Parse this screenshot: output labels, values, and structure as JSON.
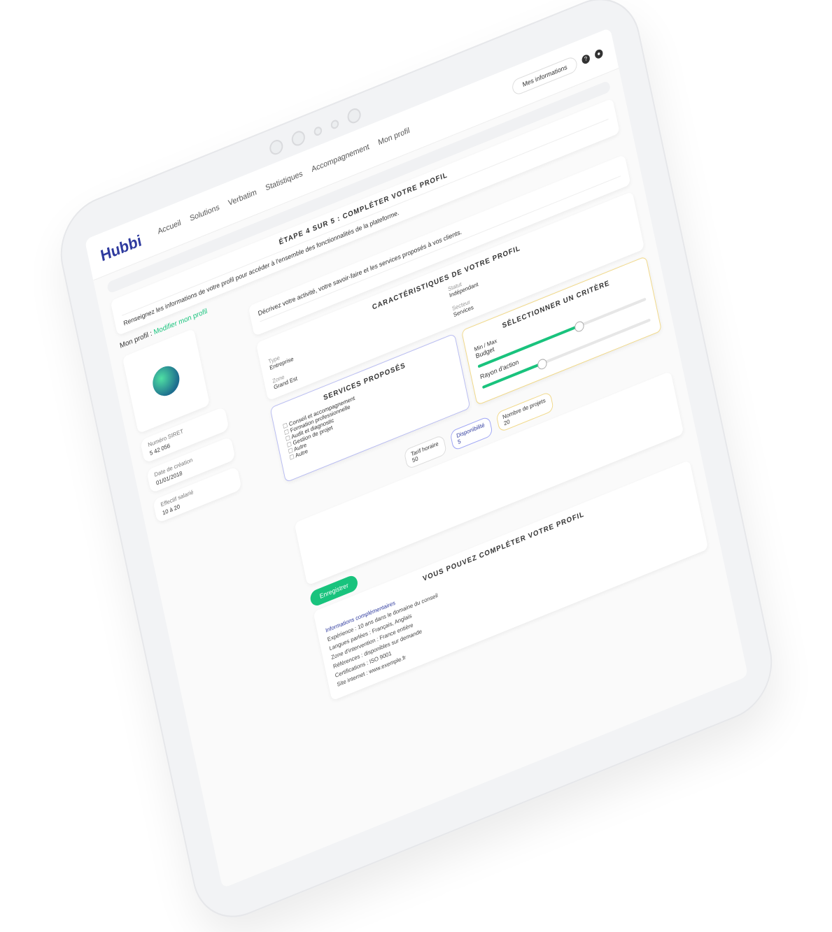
{
  "app": {
    "logo": "Hubbi",
    "logo_sub": ""
  },
  "nav": [
    "Accueil",
    "Solutions",
    "Verbatim",
    "Statistiques",
    "Accompagnement",
    "Mon profil"
  ],
  "topbar": {
    "button": "Mes informations",
    "help_icon": "?",
    "user_icon": "●"
  },
  "banner": {
    "title": "ÉTAPE 4 SUR 5 : COMPLÉTER VOTRE PROFIL",
    "title_green": "COMPLÉTER VOTRE PROFIL",
    "text": "Renseignez les informations de votre profil pour accéder à l'ensemble des fonctionnalités de la plateforme."
  },
  "crumb": {
    "prefix": "Mon profil :",
    "link": "Modifier mon profil"
  },
  "left": {
    "fields": [
      {
        "label": "Numéro SIRET",
        "value": "5 42 056"
      },
      {
        "label": "Date de création",
        "value": "01/01/2018"
      },
      {
        "label": "Effectif salarié",
        "value": "10 à 20"
      }
    ]
  },
  "description_card": {
    "text": "Décrivez votre activité, votre savoir-faire et les services proposés à vos clients."
  },
  "characteristics": {
    "title": "CARACTÉRISTIQUES DE VOTRE PROFIL",
    "items": [
      {
        "k": "Type",
        "v": "Entreprise"
      },
      {
        "k": "Statut",
        "v": "Indépendant"
      },
      {
        "k": "Zone",
        "v": "Grand Est"
      },
      {
        "k": "Secteur",
        "v": "Services"
      }
    ]
  },
  "services": {
    "title": "SERVICES PROPOSÉS",
    "items": [
      "Conseil et accompagnement",
      "Formation professionnelle",
      "Audit et diagnostic",
      "Gestion de projet",
      "Autre",
      "Autre"
    ]
  },
  "selection": {
    "title": "SÉLECTIONNER UN CRITÈRE",
    "rows": [
      {
        "label": "Budget",
        "value": 0.6
      },
      {
        "label": "Rayon d'action",
        "value": 0.35
      }
    ],
    "labels": [
      "Min",
      "Max"
    ]
  },
  "inputs": [
    {
      "label": "Tarif horaire",
      "value": "50"
    },
    {
      "label": "Disponibilité",
      "value": "5"
    },
    {
      "label": "Nombre de projets",
      "value": "20"
    }
  ],
  "footer": {
    "cta": "Enregistrer",
    "section_title": "VOUS POUVEZ COMPLÉTER VOTRE PROFIL",
    "link": "Informations complémentaires",
    "details": [
      "Expérience : 10 ans dans le domaine du conseil",
      "Langues parlées : Français, Anglais",
      "Zone d'intervention : France entière",
      "Références : disponibles sur demande",
      "Certifications : ISO 9001",
      "Site internet : www.exemple.fr"
    ]
  }
}
